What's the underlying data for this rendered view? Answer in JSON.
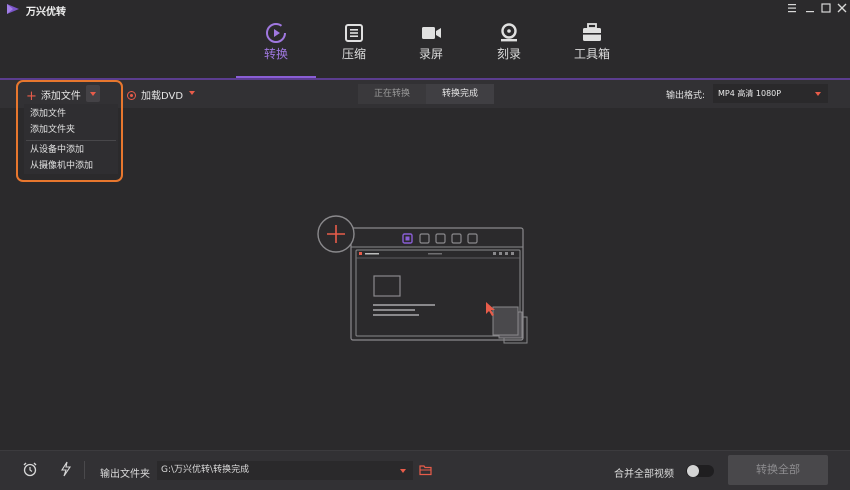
{
  "app": {
    "title": "万兴优转"
  },
  "colors": {
    "accent": "#8a5ed6",
    "brand_red": "#e85c4a",
    "highlight": "#e8772e",
    "background": "#2b2a2c"
  },
  "window_controls": [
    "menu-icon",
    "minimize-icon",
    "maximize-icon",
    "close-icon"
  ],
  "nav": {
    "items": [
      {
        "label": "转换",
        "icon": "convert-icon",
        "active": true
      },
      {
        "label": "压缩",
        "icon": "compress-icon",
        "active": false
      },
      {
        "label": "录屏",
        "icon": "record-icon",
        "active": false
      },
      {
        "label": "刻录",
        "icon": "burn-icon",
        "active": false
      },
      {
        "label": "工具箱",
        "icon": "toolbox-icon",
        "active": false
      }
    ]
  },
  "toolbar": {
    "add_file": "添加文件",
    "load_dvd": "加载DVD",
    "tabs": [
      {
        "label": "正在转换",
        "active": false
      },
      {
        "label": "转换完成",
        "active": true
      }
    ],
    "output_format_label": "输出格式:",
    "output_format_value": "MP4 高清 1080P"
  },
  "add_menu": {
    "items": [
      "添加文件",
      "添加文件夹",
      "从设备中添加",
      "从摄像机中添加"
    ]
  },
  "bottom": {
    "output_folder_label": "输出文件夹",
    "output_folder_path": "G:\\万兴优转\\转换完成",
    "merge_label": "合并全部视频",
    "merge_enabled": false,
    "convert_all": "转换全部"
  }
}
